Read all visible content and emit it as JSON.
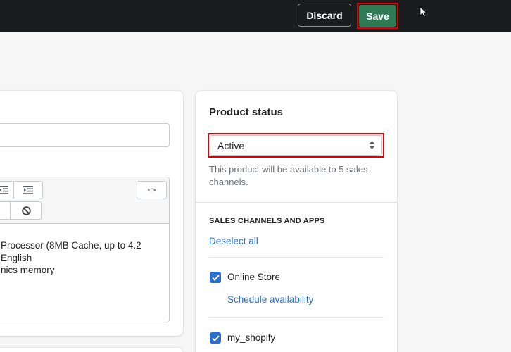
{
  "topbar": {
    "discard_label": "Discard",
    "save_label": "Save"
  },
  "editor": {
    "lines": [
      "Processor (8MB Cache, up to 4.2",
      "English",
      "nics memory"
    ],
    "toolbar_icons": [
      "outdent-icon",
      "indent-icon",
      "code-view-icon",
      "clear-format-icon"
    ],
    "code_view_label": "<>"
  },
  "product_status": {
    "title": "Product status",
    "selected": "Active",
    "help_text": "This product will be available to 5 sales channels."
  },
  "sales_channels": {
    "heading": "SALES CHANNELS AND APPS",
    "deselect_label": "Deselect all",
    "items": [
      {
        "label": "Online Store",
        "checked": true,
        "schedule_label": "Schedule availability"
      },
      {
        "label": "my_shopify",
        "checked": true
      }
    ]
  },
  "colors": {
    "topbar": "#1a1c1d",
    "save_button": "#2d7a55",
    "highlight": "#e00000",
    "link": "#2c6ecb",
    "checkbox": "#2c6ecb"
  }
}
